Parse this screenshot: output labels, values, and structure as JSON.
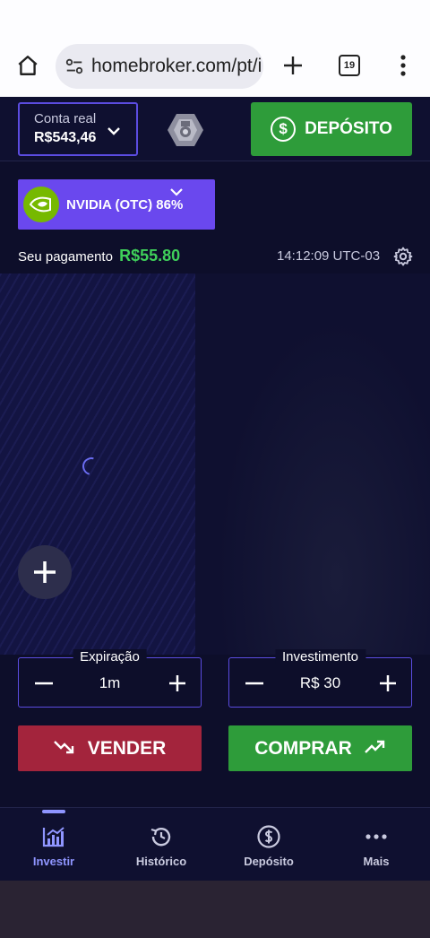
{
  "browser": {
    "url": "homebroker.com/pt/i",
    "tab_count": "19"
  },
  "header": {
    "account_label": "Conta real",
    "balance": "R$543,46",
    "deposit_label": "DEPÓSITO"
  },
  "asset": {
    "name": "NVIDIA (OTC) 86%"
  },
  "payment": {
    "label": "Seu pagamento",
    "amount": "R$55.80",
    "time": "14:12:09 UTC-03"
  },
  "expiration": {
    "title": "Expiração",
    "value": "1m"
  },
  "investment": {
    "title": "Investimento",
    "value": "R$ 30"
  },
  "actions": {
    "sell_label": "VENDER",
    "buy_label": "COMPRAR"
  },
  "nav": {
    "items": [
      {
        "label": "Investir",
        "icon": "chart-icon"
      },
      {
        "label": "Histórico",
        "icon": "history-icon"
      },
      {
        "label": "Depósito",
        "icon": "dollar-icon"
      },
      {
        "label": "Mais",
        "icon": "more-icon"
      }
    ]
  },
  "colors": {
    "accent": "#6a48ee",
    "buy": "#2e9c3a",
    "sell": "#a3243c",
    "payout": "#3fd05a",
    "background": "#0d0e2a"
  }
}
